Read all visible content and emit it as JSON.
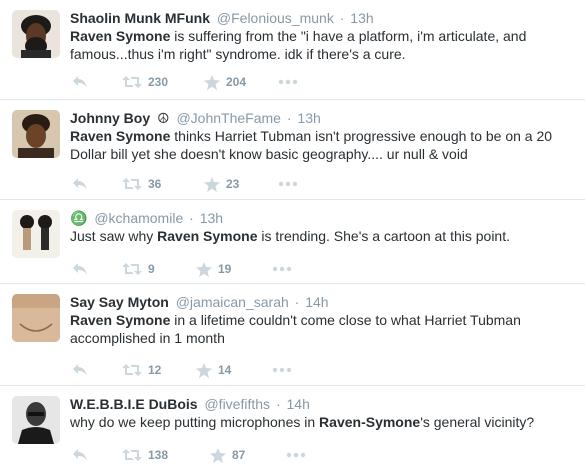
{
  "tweets": [
    {
      "fullname": "Shaolin Munk MFunk",
      "glyph": "",
      "handle": "@Felonious_munk",
      "time": "13h",
      "text_bold": "Raven Symone",
      "text_rest": " is suffering from the \"i have a platform, i'm articulate, and famous...thus i'm right\" syndrome. idk if there's a cure.",
      "retweets": "230",
      "favorites": "204"
    },
    {
      "fullname": "Johnny Boy",
      "glyph": "☮",
      "handle": "@JohnTheFame",
      "time": "13h",
      "text_bold": "Raven Symone",
      "text_rest": " thinks Harriet Tubman isn't progressive enough to be on a 20 Dollar bill yet she doesn't know basic geography.... ur null & void",
      "retweets": "36",
      "favorites": "23"
    },
    {
      "fullname": "",
      "glyph": "♎",
      "handle": "@kchamomile",
      "time": "13h",
      "text_pre": "Just saw why ",
      "text_bold": "Raven Symone",
      "text_rest": " is trending. She's a cartoon at this point.",
      "retweets": "9",
      "favorites": "19"
    },
    {
      "fullname": "Say Say Myton",
      "glyph": "",
      "handle": "@jamaican_sarah",
      "time": "14h",
      "text_bold": "Raven Symone",
      "text_rest": " in a lifetime couldn't come close to what Harriet Tubman accomplished in 1 month",
      "retweets": "12",
      "favorites": "14"
    },
    {
      "fullname": "W.E.B.B.I.E DuBois",
      "glyph": "",
      "handle": "@fivefifths",
      "time": "14h",
      "text_pre": "why do we keep putting microphones in ",
      "text_bold": "Raven-Symone",
      "text_rest": "'s general vicinity?",
      "retweets": "138",
      "favorites": "87"
    }
  ],
  "icons": {
    "reply": "reply-icon",
    "retweet": "retweet-icon",
    "favorite": "star-icon",
    "more": "more-icon"
  },
  "colors": {
    "action_gray": "#ccd6dd",
    "meta_gray": "#8899a6",
    "text": "#292f33",
    "divider": "#e1e8ed"
  }
}
